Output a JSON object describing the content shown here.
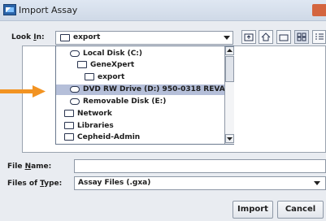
{
  "window": {
    "title": "Import Assay"
  },
  "look_in": {
    "label_prefix": "Look ",
    "label_mnemonic": "I",
    "label_suffix": "n:",
    "value": "export"
  },
  "dropdown": {
    "items": [
      {
        "label": "Local Disk (C:)",
        "icon": "hard-disk-icon",
        "selected": false
      },
      {
        "label": "GeneXpert",
        "icon": "folder-icon",
        "selected": false
      },
      {
        "label": "export",
        "icon": "folder-icon",
        "selected": false
      },
      {
        "label": "DVD RW Drive (D:) 950-0318 REVA",
        "icon": "dvd-drive-icon",
        "selected": true
      },
      {
        "label": "Removable Disk (E:)",
        "icon": "removable-disk-icon",
        "selected": false
      },
      {
        "label": "Network",
        "icon": "folder-icon",
        "selected": false
      },
      {
        "label": "Libraries",
        "icon": "folder-icon",
        "selected": false
      },
      {
        "label": "Cepheid-Admin",
        "icon": "folder-icon",
        "selected": false
      }
    ]
  },
  "file_name": {
    "label_prefix": "File ",
    "label_mnemonic": "N",
    "label_suffix": "ame:",
    "value": ""
  },
  "files_of_type": {
    "label_prefix": "Files of ",
    "label_mnemonic": "T",
    "label_suffix": "ype:",
    "value": "Assay Files (.gxa)"
  },
  "buttons": {
    "import": "Import",
    "cancel": "Cancel"
  },
  "colors": {
    "selection": "#b5bfd9",
    "callout_arrow": "#f29322",
    "close_button": "#d4653f"
  }
}
